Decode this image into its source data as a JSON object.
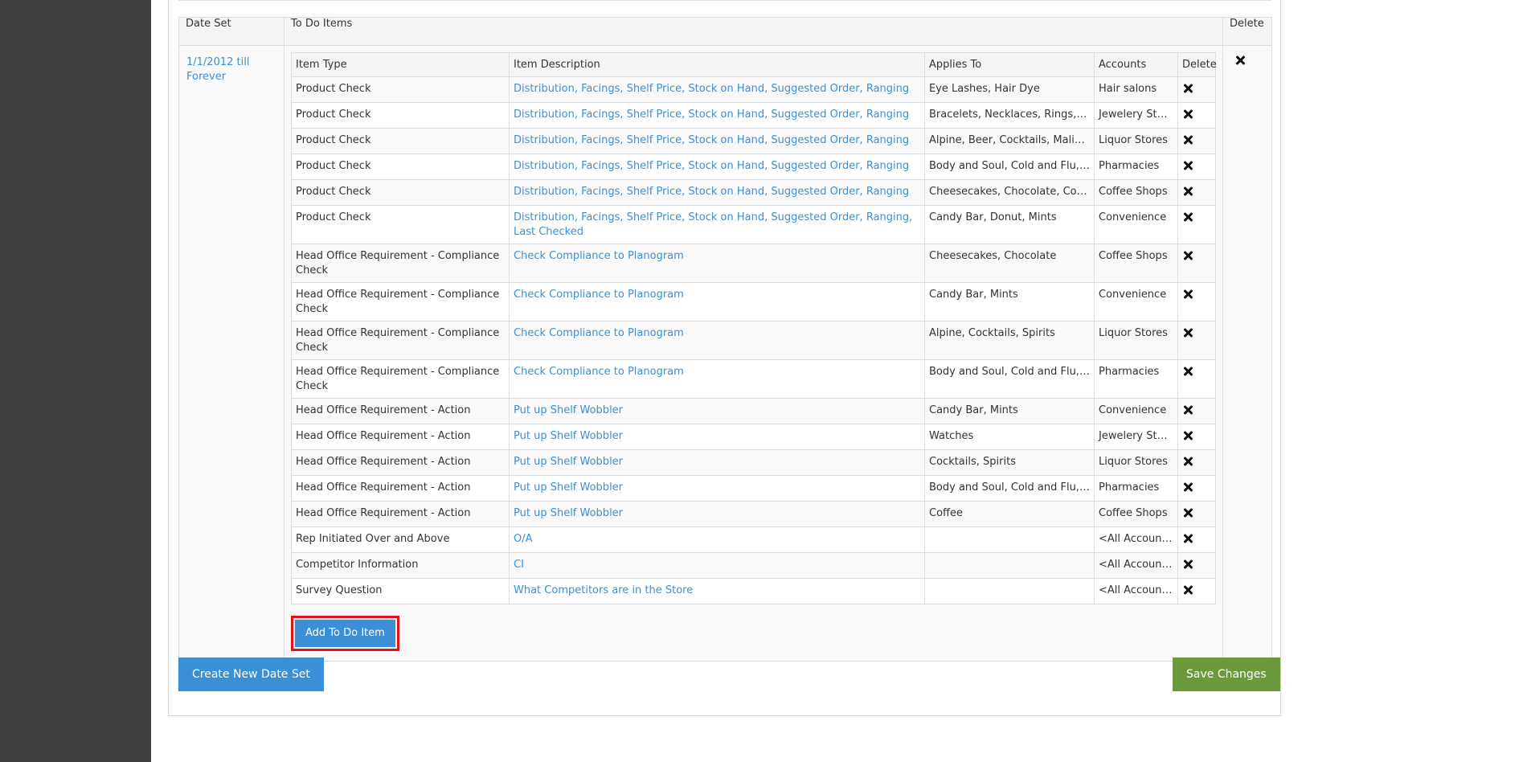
{
  "outer_table": {
    "headers": {
      "date_set": "Date Set",
      "todo_items": "To Do Items",
      "delete": "Delete"
    },
    "date_set_label": "1/1/2012 till Forever"
  },
  "inner_table": {
    "headers": {
      "item_type": "Item Type",
      "item_description": "Item Description",
      "applies_to": "Applies To",
      "accounts": "Accounts",
      "delete": "Delete"
    },
    "rows": [
      {
        "type": "Product Check",
        "description": "Distribution, Facings, Shelf Price, Stock on Hand, Suggested Order, Ranging",
        "applies_to": "Eye Lashes, Hair Dye",
        "accounts": "Hair salons"
      },
      {
        "type": "Product Check",
        "description": "Distribution, Facings, Shelf Price, Stock on Hand, Suggested Order, Ranging",
        "applies_to": "Bracelets, Necklaces, Rings, Watches",
        "accounts": "Jewelery Stores"
      },
      {
        "type": "Product Check",
        "description": "Distribution, Facings, Shelf Price, Stock on Hand, Suggested Order, Ranging",
        "applies_to": "Alpine, Beer, Cocktails, Malibu, Spirits",
        "accounts": "Liquor Stores"
      },
      {
        "type": "Product Check",
        "description": "Distribution, Facings, Shelf Price, Stock on Hand, Suggested Order, Ranging",
        "applies_to": "Body and Soul, Cold and Flu, Gifts, Vitamins",
        "accounts": "Pharmacies"
      },
      {
        "type": "Product Check",
        "description": "Distribution, Facings, Shelf Price, Stock on Hand, Suggested Order, Ranging",
        "applies_to": "Cheesecakes, Chocolate, Coffee",
        "accounts": "Coffee Shops"
      },
      {
        "type": "Product Check",
        "description": "Distribution, Facings, Shelf Price, Stock on Hand, Suggested Order, Ranging, Last Checked",
        "applies_to": "Candy Bar, Donut, Mints",
        "accounts": "Convenience"
      },
      {
        "type": "Head Office Requirement - Compliance Check",
        "description": "Check Compliance to Planogram",
        "applies_to": "Cheesecakes, Chocolate",
        "accounts": "Coffee Shops"
      },
      {
        "type": "Head Office Requirement - Compliance Check",
        "description": "Check Compliance to Planogram",
        "applies_to": "Candy Bar, Mints",
        "accounts": "Convenience"
      },
      {
        "type": "Head Office Requirement - Compliance Check",
        "description": "Check Compliance to Planogram",
        "applies_to": "Alpine, Cocktails, Spirits",
        "accounts": "Liquor Stores"
      },
      {
        "type": "Head Office Requirement - Compliance Check",
        "description": "Check Compliance to Planogram",
        "applies_to": "Body and Soul, Cold and Flu, Vitamins",
        "accounts": "Pharmacies"
      },
      {
        "type": "Head Office Requirement - Action",
        "description": "Put up Shelf Wobbler",
        "applies_to": "Candy Bar, Mints",
        "accounts": "Convenience"
      },
      {
        "type": "Head Office Requirement - Action",
        "description": "Put up Shelf Wobbler",
        "applies_to": "Watches",
        "accounts": "Jewelery Stores"
      },
      {
        "type": "Head Office Requirement - Action",
        "description": "Put up Shelf Wobbler",
        "applies_to": "Cocktails, Spirits",
        "accounts": "Liquor Stores"
      },
      {
        "type": "Head Office Requirement - Action",
        "description": "Put up Shelf Wobbler",
        "applies_to": "Body and Soul, Cold and Flu, Gifts",
        "accounts": "Pharmacies"
      },
      {
        "type": "Head Office Requirement - Action",
        "description": "Put up Shelf Wobbler",
        "applies_to": "Coffee",
        "accounts": "Coffee Shops"
      },
      {
        "type": "Rep Initiated Over and Above",
        "description": "O/A",
        "applies_to": "",
        "accounts": "<All Accounts>"
      },
      {
        "type": "Competitor Information",
        "description": "CI",
        "applies_to": "",
        "accounts": "<All Accounts>"
      },
      {
        "type": "Survey Question",
        "description": "What Competitors are in the Store",
        "applies_to": "",
        "accounts": "<All Accounts>"
      }
    ]
  },
  "buttons": {
    "add_todo": "Add To Do Item",
    "create_date_set": "Create New Date Set",
    "save_changes": "Save Changes"
  },
  "icons": {
    "delete": "close-icon"
  },
  "colors": {
    "link": "#3a8fd6",
    "primary_button": "#3a8fd6",
    "save_button": "#6a9a3a",
    "highlight": "#e1141d",
    "sidebar": "#3f3f3f"
  }
}
